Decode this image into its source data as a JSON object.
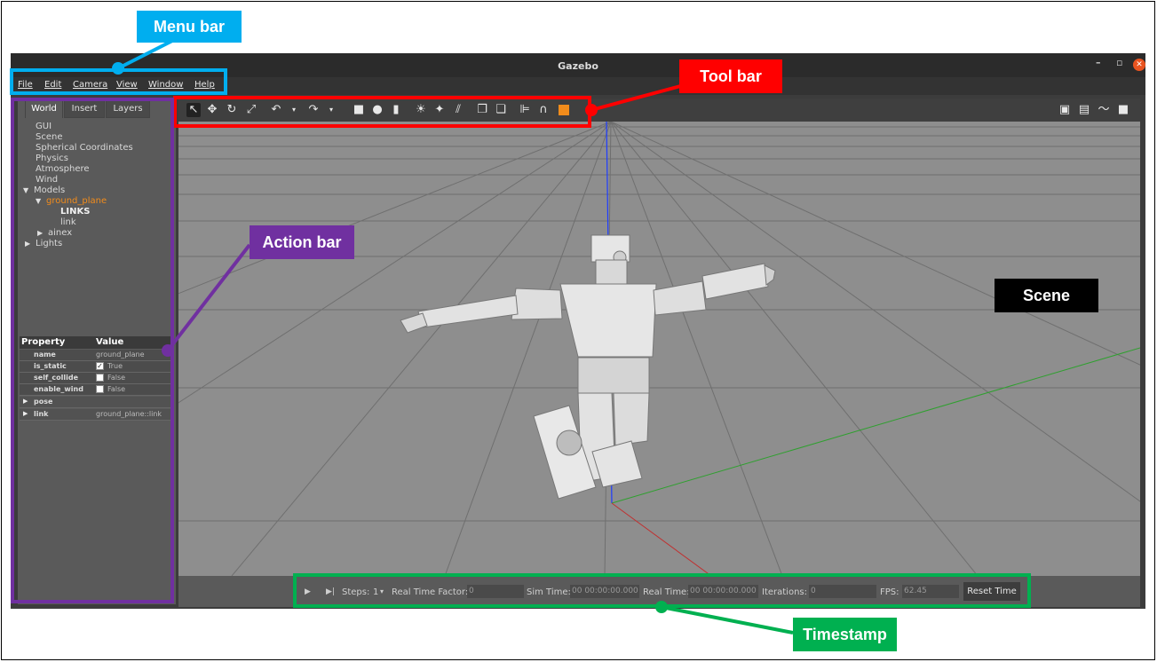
{
  "window": {
    "title": "Gazebo",
    "min_glyph": "–",
    "max_glyph": "▫",
    "close_glyph": "✕"
  },
  "menu": [
    "File",
    "Edit",
    "Camera",
    "View",
    "Window",
    "Help"
  ],
  "tabs": [
    "World",
    "Insert",
    "Layers"
  ],
  "tree": {
    "gui": "GUI",
    "scene": "Scene",
    "spherical": "Spherical Coordinates",
    "physics": "Physics",
    "atmosphere": "Atmosphere",
    "wind": "Wind",
    "models": "Models",
    "ground_plane": "ground_plane",
    "links": "LINKS",
    "link": "link",
    "ainex": "ainex",
    "lights": "Lights"
  },
  "properties": {
    "header_property": "Property",
    "header_value": "Value",
    "rows": [
      {
        "key": "name",
        "value": "ground_plane"
      },
      {
        "key": "is_static",
        "value": "True",
        "checked": true
      },
      {
        "key": "self_collide",
        "value": "False",
        "checked": false
      },
      {
        "key": "enable_wind",
        "value": "False",
        "checked": false
      },
      {
        "key": "pose",
        "value": ""
      },
      {
        "key": "link",
        "value": "ground_plane::link"
      }
    ]
  },
  "bottom": {
    "steps_label": "Steps:",
    "steps_value": "1",
    "rtf_label": "Real Time Factor:",
    "rtf_value": "0",
    "sim_label": "Sim Time:",
    "sim_value": "00 00:00:00.000",
    "real_label": "Real Time:",
    "real_value": "00 00:00:00.000",
    "iter_label": "Iterations:",
    "iter_value": "0",
    "fps_label": "FPS:",
    "fps_value": "62.45",
    "reset_label": "Reset Time"
  },
  "annotations": {
    "menu_bar": "Menu bar",
    "tool_bar": "Tool bar",
    "action_bar": "Action bar",
    "scene": "Scene",
    "timestamp": "Timestamp"
  },
  "colors": {
    "menu_annot": "#00aeef",
    "tool_annot": "#ff0000",
    "action_annot": "#7030a0",
    "scene_annot": "#000000",
    "time_annot": "#00b050",
    "highlight": "#f28c1b"
  }
}
